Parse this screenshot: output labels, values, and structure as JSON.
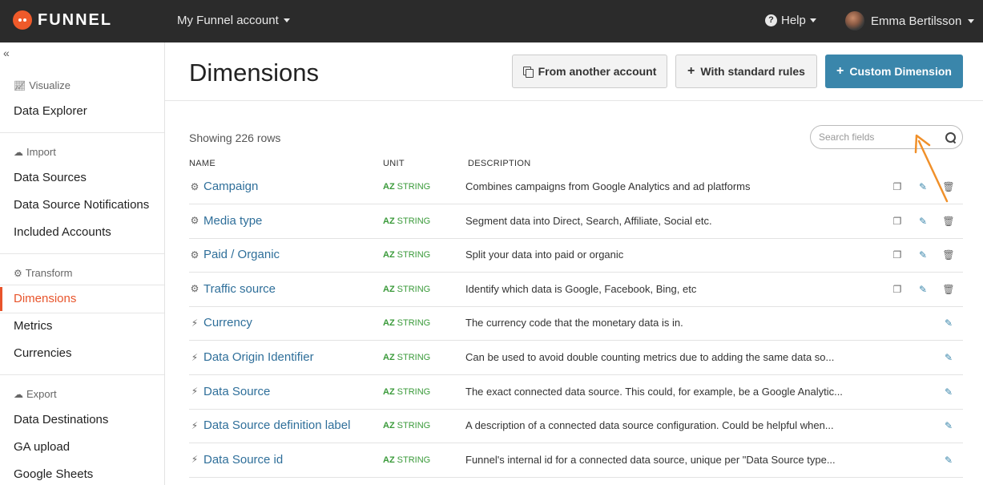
{
  "brand": {
    "name": "FUNNEL"
  },
  "account": {
    "label": "My Funnel account"
  },
  "help": {
    "label": "Help"
  },
  "user": {
    "name": "Emma Bertilsson"
  },
  "sidebar": {
    "sections": [
      {
        "title": "Visualize",
        "icon": "chart-icon",
        "items": [
          {
            "label": "Data Explorer"
          }
        ]
      },
      {
        "title": "Import",
        "icon": "cloud-upload-icon",
        "items": [
          {
            "label": "Data Sources"
          },
          {
            "label": "Data Source Notifications"
          },
          {
            "label": "Included Accounts"
          }
        ]
      },
      {
        "title": "Transform",
        "icon": "gear-icon",
        "items": [
          {
            "label": "Dimensions",
            "active": true
          },
          {
            "label": "Metrics"
          },
          {
            "label": "Currencies"
          }
        ]
      },
      {
        "title": "Export",
        "icon": "cloud-download-icon",
        "items": [
          {
            "label": "Data Destinations"
          },
          {
            "label": "GA upload"
          },
          {
            "label": "Google Sheets"
          }
        ]
      }
    ]
  },
  "page": {
    "title": "Dimensions",
    "buttons": {
      "from_account": "From another account",
      "standard_rules": "With standard rules",
      "custom": "Custom Dimension"
    },
    "showing": "Showing 226 rows",
    "search_placeholder": "Search fields",
    "columns": {
      "name": "NAME",
      "unit": "UNIT",
      "description": "DESCRIPTION"
    }
  },
  "rows": [
    {
      "name": "Campaign",
      "icon": "gear-icon",
      "unit_prefix": "AZ",
      "unit": "STRING",
      "description": "Combines campaigns from Google Analytics and ad platforms",
      "actions": [
        "copy",
        "edit",
        "delete"
      ]
    },
    {
      "name": "Media type",
      "icon": "gear-icon",
      "unit_prefix": "AZ",
      "unit": "STRING",
      "description": "Segment data into Direct, Search, Affiliate, Social etc.",
      "actions": [
        "copy",
        "edit",
        "delete"
      ]
    },
    {
      "name": "Paid / Organic",
      "icon": "gear-icon",
      "unit_prefix": "AZ",
      "unit": "STRING",
      "description": "Split your data into paid or organic",
      "actions": [
        "copy",
        "edit",
        "delete"
      ]
    },
    {
      "name": "Traffic source",
      "icon": "gear-icon",
      "unit_prefix": "AZ",
      "unit": "STRING",
      "description": "Identify which data is Google, Facebook, Bing, etc",
      "actions": [
        "copy",
        "edit",
        "delete"
      ]
    },
    {
      "name": "Currency",
      "icon": "plug-icon",
      "unit_prefix": "AZ",
      "unit": "STRING",
      "description": "The currency code that the monetary data is in.",
      "actions": [
        "edit"
      ]
    },
    {
      "name": "Data Origin Identifier",
      "icon": "plug-icon",
      "unit_prefix": "AZ",
      "unit": "STRING",
      "description": "Can be used to avoid double counting metrics due to adding the same data so...",
      "actions": [
        "edit"
      ]
    },
    {
      "name": "Data Source",
      "icon": "plug-icon",
      "unit_prefix": "AZ",
      "unit": "STRING",
      "description": "The exact connected data source. This could, for example, be a Google Analytic...",
      "actions": [
        "edit"
      ]
    },
    {
      "name": "Data Source definition label",
      "icon": "plug-icon",
      "unit_prefix": "AZ",
      "unit": "STRING",
      "description": "A description of a connected data source configuration. Could be helpful when...",
      "actions": [
        "edit"
      ]
    },
    {
      "name": "Data Source id",
      "icon": "plug-icon",
      "unit_prefix": "AZ",
      "unit": "STRING",
      "description": "Funnel's internal id for a connected data source, unique per \"Data Source type...",
      "actions": [
        "edit"
      ]
    }
  ],
  "colors": {
    "accent": "#e8542b",
    "primary": "#3a86ab",
    "link": "#2f6f9a",
    "unit": "#3a9a3a",
    "annotation": "#f0902a"
  }
}
